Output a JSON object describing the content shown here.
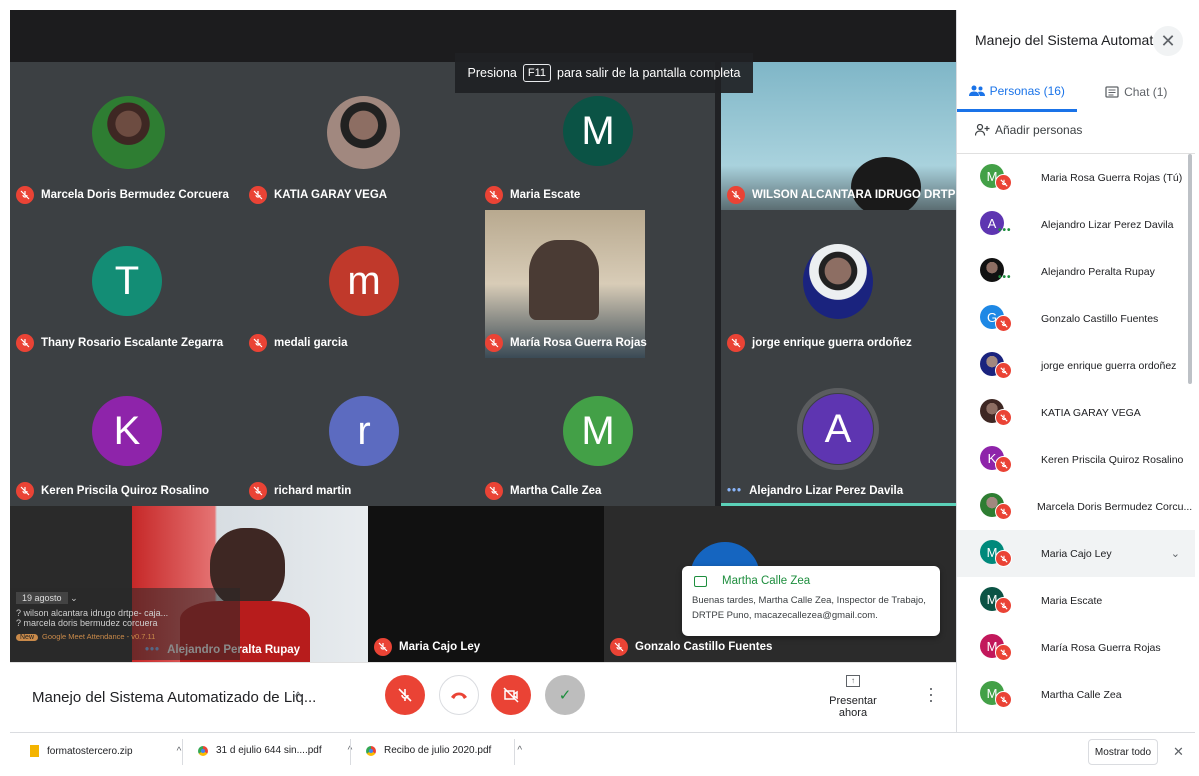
{
  "fullscreen_hint": {
    "prefix": "Presiona",
    "key": "F11",
    "suffix": "para salir de la pantalla completa"
  },
  "tiles": [
    {
      "name": "Marcela Doris Bermudez Corcuera",
      "status": "muted"
    },
    {
      "name": "KATIA GARAY VEGA",
      "status": "muted"
    },
    {
      "name": "Maria Escate",
      "status": "muted",
      "initial": "M",
      "color": "#0b5345"
    },
    {
      "name": "WILSON ALCANTARA IDRUGO DRTPE- CAJ...",
      "status": "muted"
    },
    {
      "name": "Thany Rosario Escalante Zegarra",
      "status": "muted",
      "initial": "T",
      "color": "#138d75"
    },
    {
      "name": "medali garcia",
      "status": "muted",
      "initial": "m",
      "color": "#c0392b"
    },
    {
      "name": "María Rosa Guerra Rojas",
      "status": "muted"
    },
    {
      "name": "jorge enrique guerra ordoñez",
      "status": "muted"
    },
    {
      "name": "Keren Priscila Quiroz Rosalino",
      "status": "muted",
      "initial": "K",
      "color": "#8e24aa"
    },
    {
      "name": "richard martin",
      "status": "muted",
      "initial": "r",
      "color": "#5c6bc0"
    },
    {
      "name": "Martha Calle Zea",
      "status": "muted",
      "initial": "M",
      "color": "#43a047"
    },
    {
      "name": "Alejandro Lizar Perez Davila",
      "status": "speaking",
      "initial": "A",
      "color": "#5e35b1"
    },
    {
      "name": "Alejandro Peralta Rupay",
      "status": "speaking"
    },
    {
      "name": "Maria Cajo Ley",
      "status": "muted"
    },
    {
      "name": "Gonzalo Castillo Fuentes",
      "status": "muted"
    }
  ],
  "panel": {
    "title": "Manejo del Sistema Automat...",
    "tab_people": "Personas (16)",
    "tab_chat": "Chat (1)",
    "add_people": "Añadir personas",
    "participants": [
      {
        "name": "Maria Rosa Guerra Rojas (Tú)",
        "initial": "M",
        "color": "#43a047",
        "state": "muted"
      },
      {
        "name": "Alejandro Lizar Perez Davila",
        "initial": "A",
        "color": "#5e35b1",
        "state": "speaking"
      },
      {
        "name": "Alejandro Peralta Rupay",
        "initial": "",
        "color": "#222222",
        "state": "speaking"
      },
      {
        "name": "Gonzalo Castillo Fuentes",
        "initial": "G",
        "color": "#1e88e5",
        "state": "muted"
      },
      {
        "name": "jorge enrique guerra ordoñez",
        "initial": "",
        "color": "#5d4037",
        "state": "muted"
      },
      {
        "name": "KATIA GARAY VEGA",
        "initial": "",
        "color": "#6d4c41",
        "state": "muted"
      },
      {
        "name": "Keren Priscila Quiroz Rosalino",
        "initial": "K",
        "color": "#8e24aa",
        "state": "muted"
      },
      {
        "name": "Marcela Doris Bermudez Corcu...",
        "initial": "",
        "color": "#7b5e4e",
        "state": "muted"
      },
      {
        "name": "Maria Cajo Ley",
        "initial": "M",
        "color": "#00897b",
        "state": "muted"
      },
      {
        "name": "Maria Escate",
        "initial": "M",
        "color": "#0b5345",
        "state": "muted"
      },
      {
        "name": "María Rosa Guerra Rojas",
        "initial": "M",
        "color": "#c2185b",
        "state": "muted"
      },
      {
        "name": "Martha Calle Zea",
        "initial": "M",
        "color": "#43a047",
        "state": "muted"
      }
    ]
  },
  "bottom": {
    "meeting_title": "Manejo del Sistema Automatizado de Liq...",
    "present_label": "Presentar ahora"
  },
  "toast": {
    "sender": "Martha Calle Zea",
    "message": "Buenas tardes, Martha Calle Zea, Inspector de Trabajo, DRTPE Puno, macazecallezea@gmail.com."
  },
  "extension": {
    "date": "19 agosto",
    "line1": "? wilson alcantara idrugo drtpe- caja...",
    "line2": "? marcela doris bermudez corcuera",
    "badge": "New",
    "footer": "Google Meet Attendance - v0.7.11"
  },
  "downloads": [
    {
      "name": "formatostercero.zip",
      "type": "zip"
    },
    {
      "name": "31 d ejulio 644 sin....pdf",
      "type": "pdf"
    },
    {
      "name": "Recibo de julio 2020.pdf",
      "type": "pdf"
    }
  ],
  "show_all": "Mostrar todo"
}
